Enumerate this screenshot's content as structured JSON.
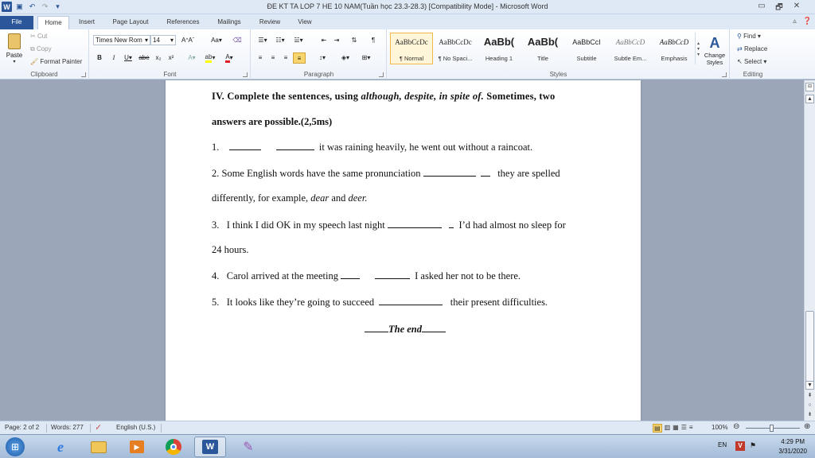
{
  "window": {
    "title": "ĐE KT TA LOP 7 HE 10 NAM(Tuần học 23.3-28.3) [Compatibility Mode] - Microsoft Word",
    "minimize": "▭",
    "restore": "🗗",
    "close": "✕"
  },
  "tabs": [
    {
      "label": "File"
    },
    {
      "label": "Home"
    },
    {
      "label": "Insert"
    },
    {
      "label": "Page Layout"
    },
    {
      "label": "References"
    },
    {
      "label": "Mailings"
    },
    {
      "label": "Review"
    },
    {
      "label": "View"
    }
  ],
  "ribbon": {
    "clipboard": {
      "label": "Clipboard",
      "paste": "Paste",
      "cut": "Cut",
      "copy": "Copy",
      "format_painter": "Format Painter"
    },
    "font": {
      "label": "Font",
      "family": "Times New Rom",
      "size": "14"
    },
    "paragraph": {
      "label": "Paragraph"
    },
    "styles": {
      "label": "Styles",
      "items": [
        {
          "sample": "AaBbCcDc",
          "name": "¶ Normal"
        },
        {
          "sample": "AaBbCcDc",
          "name": "¶ No Spaci..."
        },
        {
          "sample": "AaBb(",
          "name": "Heading 1"
        },
        {
          "sample": "AaBb(",
          "name": "Title"
        },
        {
          "sample": "AaBbCcI",
          "name": "Subtitle"
        },
        {
          "sample": "AaBbCcD",
          "name": "Subtle Em..."
        },
        {
          "sample": "AaBbCcD",
          "name": "Emphasis"
        }
      ],
      "change_styles": "Change Styles"
    },
    "editing": {
      "label": "Editing",
      "find": "Find",
      "replace": "Replace",
      "select": "Select"
    }
  },
  "document": {
    "heading_bold": "IV. Complete the sentences, using ",
    "heading_italic": "although, despite, in spite of.",
    "heading_rest": " Sometimes, two",
    "heading_line2": "answers are possible.(2,5ms)",
    "q1_num": "1.",
    "q1_text": "it was raining heavily, he went out without a raincoat.",
    "q2_text": "2. Some English words have the same pronunciation",
    "q2_rest": "they are spelled",
    "q2_line2_a": "differently, for example, ",
    "q2_line2_b": "dear",
    "q2_line2_c": " and ",
    "q2_line2_d": "deer.",
    "q3_num": "3.",
    "q3_text": "I think I did OK in my speech last night",
    "q3_rest": "I’d had almost no sleep for",
    "q3_line2": "24 hours.",
    "q4_num": "4.",
    "q4_text": "Carol arrived at the meeting",
    "q4_rest": "I asked her not to be there.",
    "q5_num": "5.",
    "q5_text": "It looks like they’re going to succeed",
    "q5_rest": "their present difficulties.",
    "the_end": "The end"
  },
  "statusbar": {
    "page": "Page: 2 of 2",
    "words": "Words: 277",
    "language": "English (U.S.)",
    "zoom": "100%"
  },
  "taskbar": {
    "lang": "EN",
    "time": "4:29 PM",
    "date": "3/31/2020"
  },
  "colors": {
    "accent": "#2b579a",
    "ribbon_bg": "#dfe9f5",
    "doc_bg": "#9ba7b8"
  }
}
